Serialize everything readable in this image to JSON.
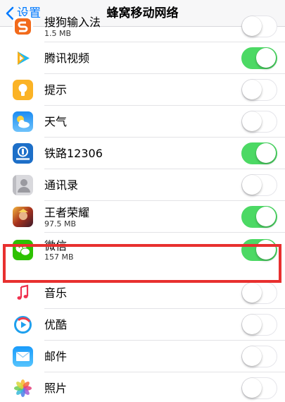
{
  "nav": {
    "back_label": "设置",
    "title": "蜂窝移动网络"
  },
  "colors": {
    "accent": "#007aff",
    "toggle_on": "#4cd964",
    "highlight": "#e8302f"
  },
  "apps": [
    {
      "name": "搜狗输入法",
      "usage": "1.5 MB",
      "enabled": false,
      "icon": "sogou-input-icon"
    },
    {
      "name": "腾讯视频",
      "usage": "",
      "enabled": true,
      "icon": "tencent-video-icon"
    },
    {
      "name": "提示",
      "usage": "",
      "enabled": false,
      "icon": "tips-icon"
    },
    {
      "name": "天气",
      "usage": "",
      "enabled": false,
      "icon": "weather-icon"
    },
    {
      "name": "铁路12306",
      "usage": "",
      "enabled": true,
      "icon": "railway-12306-icon"
    },
    {
      "name": "通讯录",
      "usage": "",
      "enabled": false,
      "icon": "contacts-icon"
    },
    {
      "name": "王者荣耀",
      "usage": "97.5 MB",
      "enabled": true,
      "icon": "honor-of-kings-icon"
    },
    {
      "name": "微信",
      "usage": "157 MB",
      "enabled": true,
      "icon": "wechat-icon"
    },
    {
      "name": "音乐",
      "usage": "",
      "enabled": false,
      "icon": "music-icon"
    },
    {
      "name": "优酷",
      "usage": "",
      "enabled": false,
      "icon": "youku-icon"
    },
    {
      "name": "邮件",
      "usage": "",
      "enabled": false,
      "icon": "mail-icon"
    },
    {
      "name": "照片",
      "usage": "",
      "enabled": false,
      "icon": "photos-icon"
    }
  ]
}
